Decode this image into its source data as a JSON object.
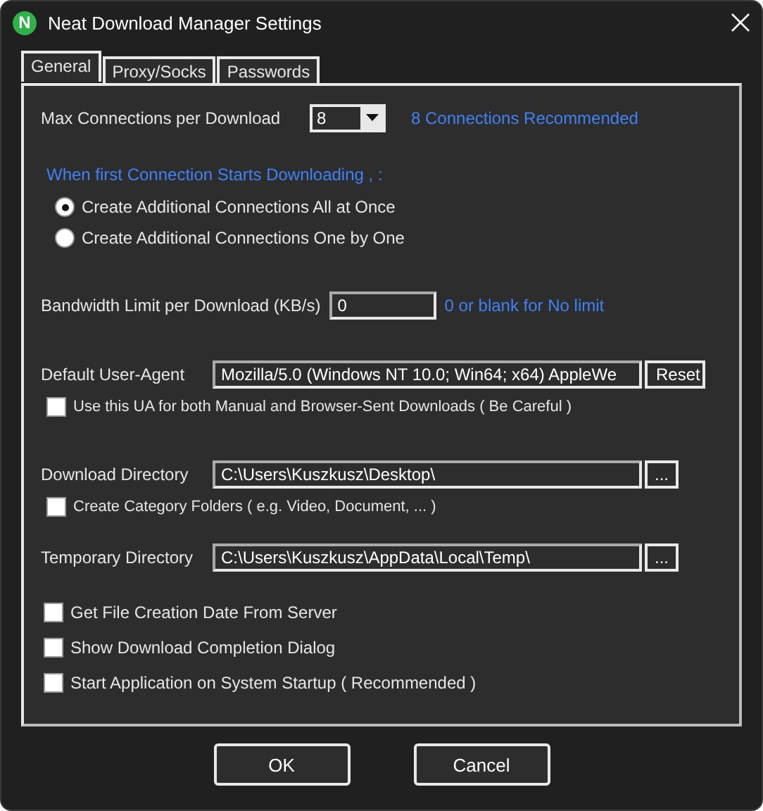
{
  "window": {
    "logo": "N",
    "title": "Neat Download Manager Settings"
  },
  "tabs": [
    {
      "label": "General",
      "selected": true
    },
    {
      "label": "Proxy/Socks",
      "selected": false
    },
    {
      "label": "Passwords",
      "selected": false
    }
  ],
  "max_connections": {
    "label": "Max Connections per Download",
    "value": "8",
    "hint": "8 Connections Recommended"
  },
  "first_connection": {
    "heading": "When first Connection Starts Downloading  , :",
    "options": [
      {
        "label": "Create Additional Connections All at Once",
        "selected": true
      },
      {
        "label": "Create Additional Connections One by One",
        "selected": false
      }
    ]
  },
  "bandwidth": {
    "label": "Bandwidth Limit per Download (KB/s)",
    "value": "0",
    "hint": "0 or blank for No limit"
  },
  "user_agent": {
    "label": "Default User-Agent",
    "value": "Mozilla/5.0 (Windows NT 10.0; Win64; x64) AppleWe",
    "reset_button": "Reset",
    "checkbox": {
      "label": "Use this UA for both Manual and Browser-Sent Downloads ( Be Careful )",
      "checked": false
    }
  },
  "download_directory": {
    "label": "Download Directory",
    "value": "C:\\Users\\Kuszkusz\\Desktop\\",
    "browse_button": "...",
    "checkbox": {
      "label": "Create Category Folders ( e.g.  Video, Document, ...  )",
      "checked": false
    }
  },
  "temporary_directory": {
    "label": "Temporary Directory",
    "value": "C:\\Users\\Kuszkusz\\AppData\\Local\\Temp\\",
    "browse_button": "..."
  },
  "options": [
    {
      "label": "Get File Creation Date From Server",
      "checked": false
    },
    {
      "label": "Show Download Completion Dialog",
      "checked": false
    },
    {
      "label": "Start Application on System Startup ( Recommended )",
      "checked": false
    }
  ],
  "buttons": [
    "OK",
    "Cancel"
  ]
}
